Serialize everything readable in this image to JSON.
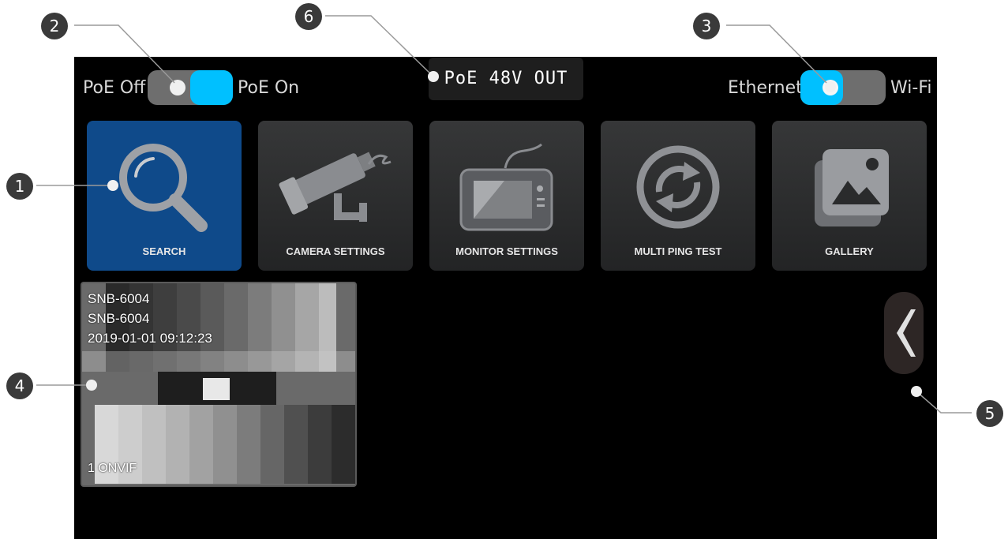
{
  "toggles": {
    "poe_off_label": "PoE Off",
    "poe_on_label": "PoE On",
    "ethernet_label": "Ethernet",
    "wifi_label": "Wi-Fi",
    "poe_state": "on",
    "network_state": "ethernet"
  },
  "poe_status": "PoE 48V OUT",
  "tiles": [
    {
      "label": "SEARCH",
      "icon": "magnifier-icon",
      "active": true
    },
    {
      "label": "CAMERA SETTINGS",
      "icon": "cctv-camera-icon",
      "active": false
    },
    {
      "label": "MONITOR SETTINGS",
      "icon": "tester-monitor-icon",
      "active": false
    },
    {
      "label": "MULTI PING TEST",
      "icon": "refresh-cycle-icon",
      "active": false
    },
    {
      "label": "GALLERY",
      "icon": "gallery-image-icon",
      "active": false
    }
  ],
  "camera_thumbnail": {
    "model": "SNB-6004",
    "name": "SNB-6004",
    "timestamp": "2019-01-01 09:12:23",
    "protocol": "1 ONVIF"
  },
  "back_button_icon": "chevron-left-icon",
  "callouts": [
    "1",
    "2",
    "3",
    "4",
    "5",
    "6"
  ],
  "colors": {
    "accent": "#00c0ff",
    "active_tile": "#0f4a8a",
    "tile": "#2a2b2c",
    "screen_bg": "#000000"
  }
}
